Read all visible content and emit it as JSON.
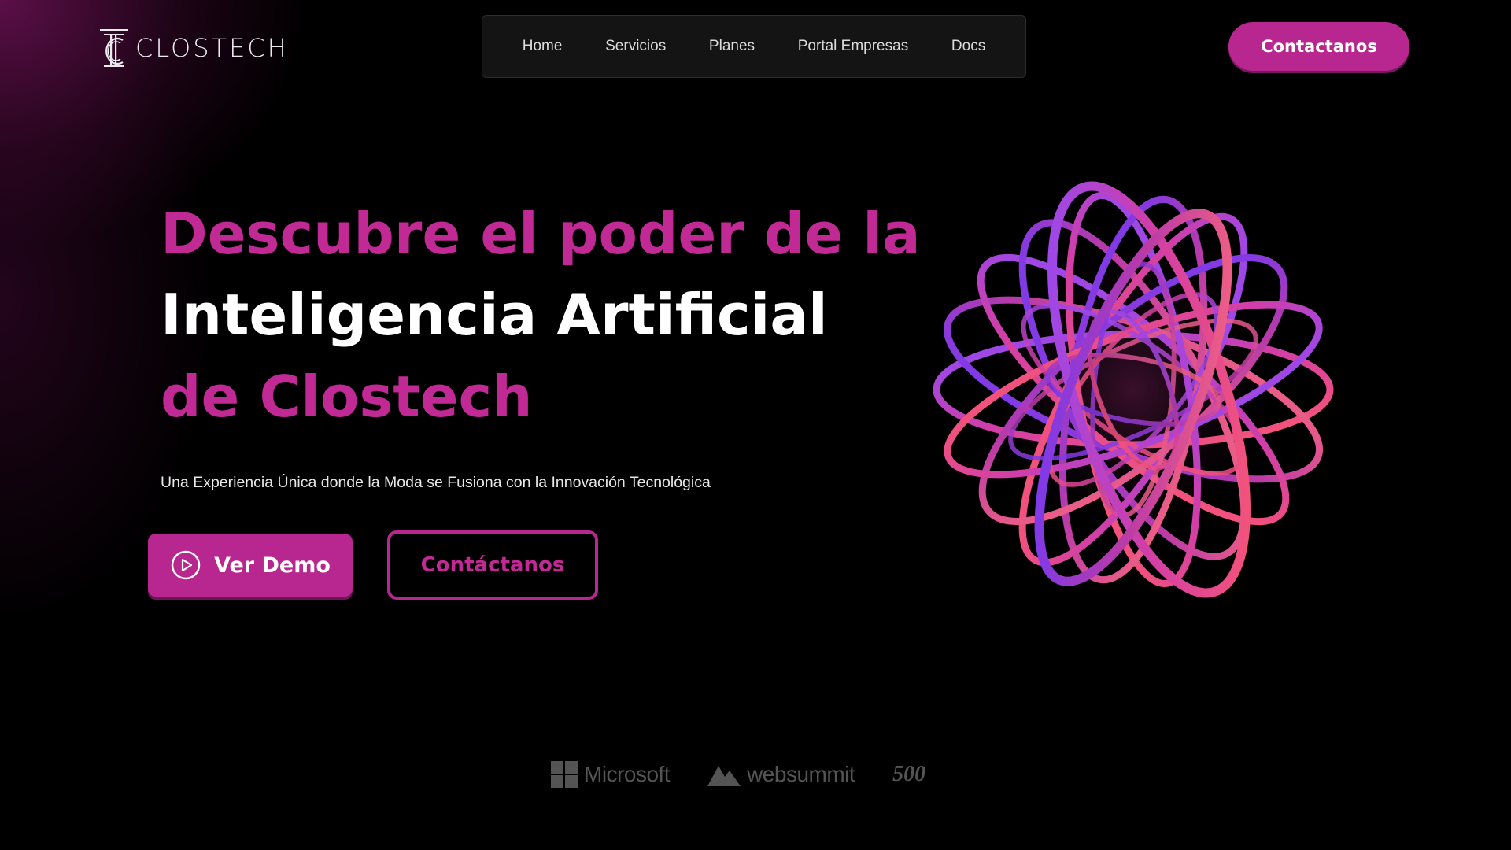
{
  "brand": {
    "name": "CLOSTECH",
    "logo_icon": "pillar-logo-icon"
  },
  "nav": {
    "items": [
      {
        "label": "Home"
      },
      {
        "label": "Servicios"
      },
      {
        "label": "Planes"
      },
      {
        "label": "Portal Empresas"
      },
      {
        "label": "Docs"
      }
    ]
  },
  "header": {
    "cta_label": "Contactanos"
  },
  "hero": {
    "line1": "Descubre el poder de la",
    "line2": "Inteligencia Artificial",
    "line3": "de Clostech",
    "subtitle": "Una Experiencia Única donde la Moda se Fusiona con la Innovación Tecnológica",
    "primary_button": {
      "label": "Ver Demo",
      "icon": "play-circle-icon"
    },
    "secondary_button": {
      "label": "Contáctanos"
    }
  },
  "partners": {
    "items": [
      {
        "label": "Microsoft",
        "icon": "windows-grid-icon"
      },
      {
        "label": "websummit",
        "icon": "mountain-icon"
      },
      {
        "label": "500"
      }
    ]
  },
  "colors": {
    "background": "#000000",
    "accent": "#b8268f",
    "accent_text": "#c12a95",
    "nav_background": "#141414",
    "text": "#ffffff"
  }
}
